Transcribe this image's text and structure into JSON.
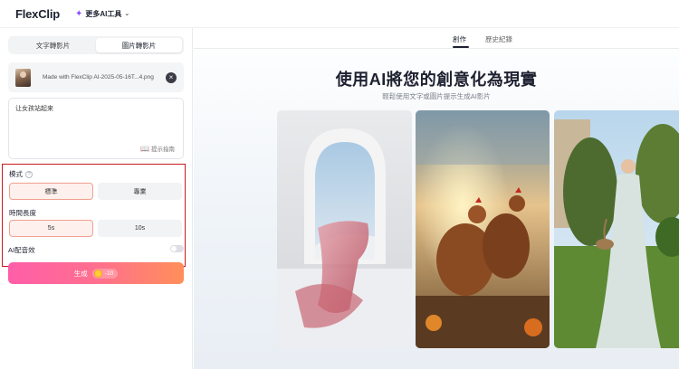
{
  "header": {
    "logo_text": "FlexClip",
    "ai_tools_label": "更多AI工具",
    "ai_tools_icon": "sparkle-icon"
  },
  "left_panel": {
    "mode_tabs": [
      {
        "label": "文字轉影片",
        "active": false
      },
      {
        "label": "圖片轉影片",
        "active": true
      }
    ],
    "file": {
      "name": "Made with FlexClip AI-2025-05-16T...4.png"
    },
    "prompt": {
      "value": "让女孩站起来",
      "guide_label": "提示指南"
    },
    "mode": {
      "label": "模式",
      "options": [
        "標準",
        "專業"
      ],
      "selected": "標準"
    },
    "duration": {
      "label": "時間長度",
      "options": [
        "5s",
        "10s"
      ],
      "selected": "5s"
    },
    "audio": {
      "label": "AI配音效",
      "enabled": false
    },
    "generate": {
      "label": "生成",
      "cost": "-10"
    }
  },
  "right_panel": {
    "tabs": [
      {
        "label": "創作",
        "active": true
      },
      {
        "label": "歷史紀錄",
        "active": false
      }
    ],
    "title": "使用AI將您的創意化為現實",
    "subtitle": "輕鬆使用文字或圖片提示生成AI影片"
  },
  "colors": {
    "accent_pink": "#ff5ea8",
    "accent_orange": "#ff8f5a",
    "highlight_red": "#c8191c",
    "selected_border": "#f2a08f"
  }
}
